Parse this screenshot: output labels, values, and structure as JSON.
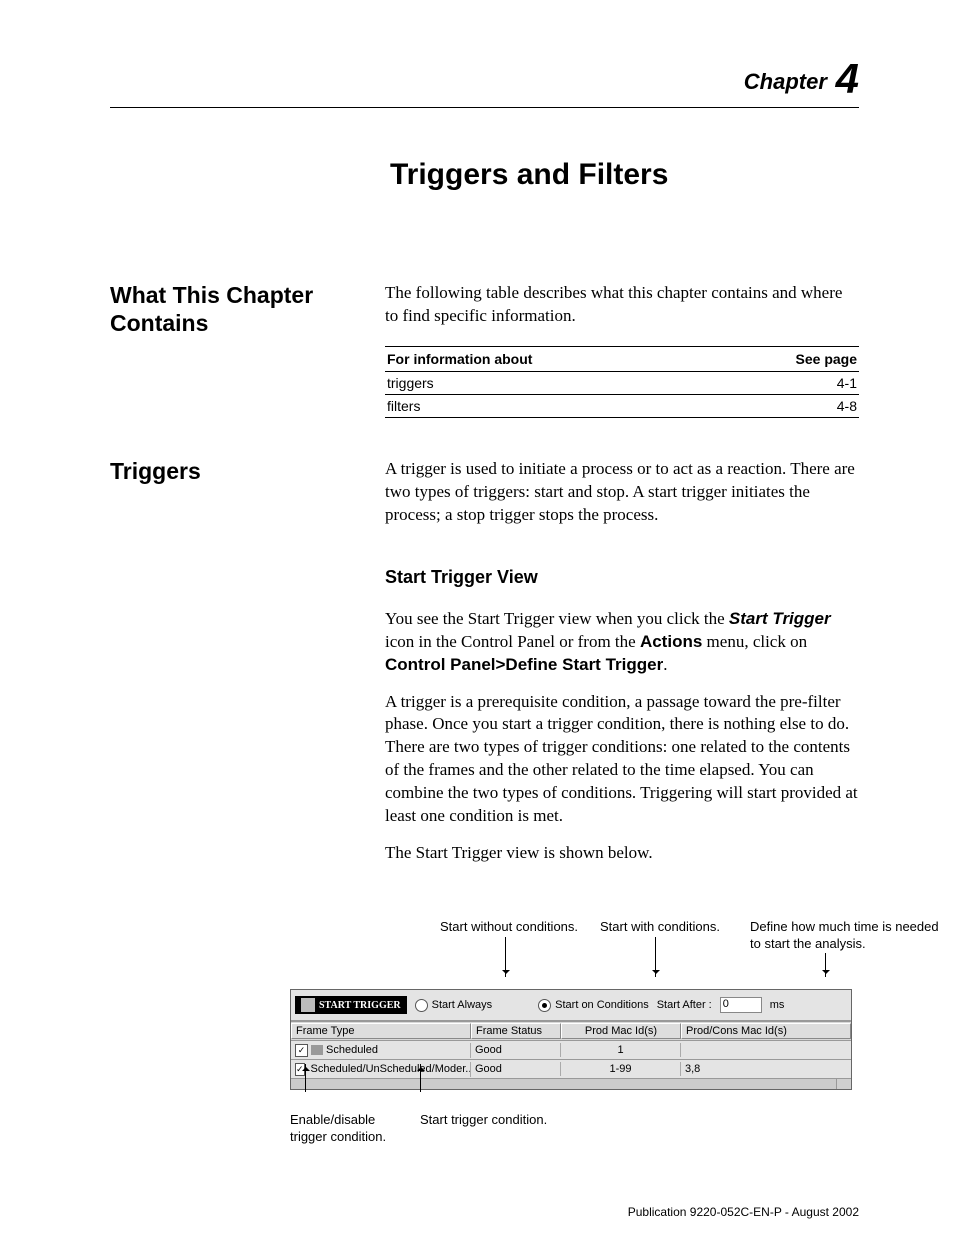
{
  "chapter": {
    "label": "Chapter",
    "number": "4"
  },
  "title": "Triggers and Filters",
  "section1": {
    "heading": "What This Chapter Contains",
    "para": "The following table describes what this chapter contains and where to find specific information.",
    "table": {
      "h1": "For information about",
      "h2": "See page",
      "rows": [
        {
          "a": "triggers",
          "b": "4-1"
        },
        {
          "a": "filters",
          "b": "4-8"
        }
      ]
    }
  },
  "section2": {
    "heading": "Triggers",
    "para": "A trigger is used to initiate a process or to act as a reaction. There are two types of triggers: start and stop. A start trigger initiates the process; a stop trigger stops the process.",
    "sub": "Start Trigger View",
    "p2a": "You see the Start Trigger view when you click the ",
    "p2b": "Start Trigger",
    "p2c": " icon in the Control Panel or from the ",
    "p2d": "Actions",
    "p2e": " menu, click on ",
    "p2f": "Control Panel>Define Start Trigger",
    "p2g": ".",
    "p3": "A trigger is a prerequisite condition, a passage toward the pre-filter phase. Once you start a trigger condition, there is nothing else to do. There are two types of trigger conditions: one related to the contents of the frames and the other related to the time elapsed. You can combine the two types of conditions. Triggering will start provided at least one condition is met.",
    "p4": "The Start Trigger view is shown below."
  },
  "callouts": {
    "c1": "Start without conditions.",
    "c2": "Start with conditions.",
    "c3": "Define how much time is needed to start the analysis.",
    "c4": "Enable/disable trigger condition.",
    "c5": "Start trigger condition."
  },
  "panel": {
    "tag": "START TRIGGER",
    "r1": "Start Always",
    "r2": "Start on Conditions",
    "after_label": "Start After :",
    "after_value": "0",
    "unit": "ms",
    "cols": {
      "ft": "Frame Type",
      "fs": "Frame Status",
      "pm": "Prod Mac Id(s)",
      "pc": "Prod/Cons Mac Id(s)"
    },
    "rows": [
      {
        "chk": "✓",
        "ft": "Scheduled",
        "fs": "Good",
        "pm": "1",
        "pc": ""
      },
      {
        "chk": "✓",
        "ft": "Scheduled/UnScheduled/Moder...",
        "fs": "Good",
        "pm": "1-99",
        "pc": "3,8"
      }
    ]
  },
  "footer": "Publication 9220-052C-EN-P - August 2002"
}
